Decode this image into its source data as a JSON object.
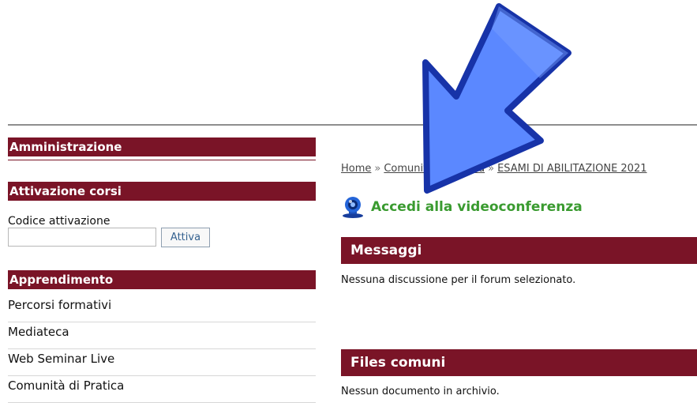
{
  "sidebar": {
    "administration_header": "Amministrazione",
    "activation_header": "Attivazione corsi",
    "activation_label": "Codice attivazione",
    "activation_input_value": "",
    "activation_button": "Attiva",
    "learning_header": "Apprendimento",
    "learning_items": [
      {
        "label": "Percorsi formativi"
      },
      {
        "label": "Mediateca"
      },
      {
        "label": "Web Seminar Live"
      },
      {
        "label": "Comunità di Pratica"
      }
    ]
  },
  "breadcrumb": {
    "home": "Home",
    "community": "Comunità di Pratica",
    "current": "ESAMI DI ABILITAZIONE 2021",
    "separator": "»"
  },
  "video_conference": {
    "label": "Accedi alla videoconferenza",
    "icon": "webcam-icon"
  },
  "messages": {
    "header": "Messaggi",
    "empty_text": "Nessuna discussione per il forum selezionato."
  },
  "shared_files": {
    "header": "Files comuni",
    "empty_text": "Nessun documento in archivio."
  },
  "overlay": {
    "icon": "arrow-pointer-icon",
    "fill_color": "#5b88ff",
    "outline_color": "#1733a8"
  },
  "colors": {
    "header_background": "#7a1427",
    "video_link": "#3a9b30",
    "button_text": "#34618f"
  }
}
